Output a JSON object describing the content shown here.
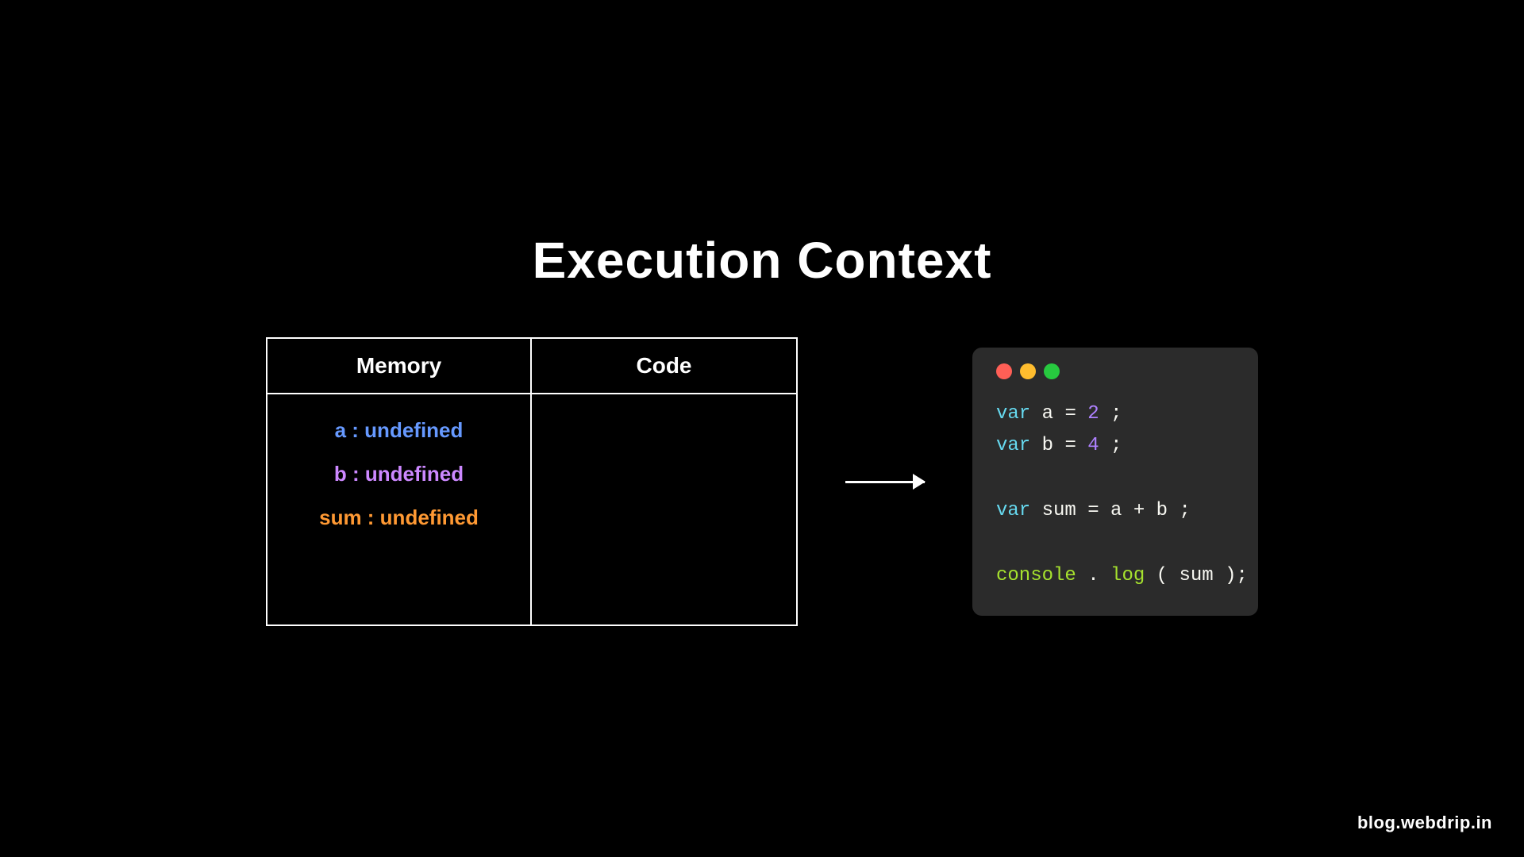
{
  "title": "Execution Context",
  "table": {
    "memory_header": "Memory",
    "code_header": "Code",
    "memory_items": [
      {
        "label": "a : undefined",
        "class": "var-a"
      },
      {
        "label": "b : undefined",
        "class": "var-b"
      },
      {
        "label": "sum : undefined",
        "class": "var-sum"
      }
    ]
  },
  "code": {
    "line1_kw": "var",
    "line1_var": "a",
    "line1_op": "=",
    "line1_num": "2",
    "line2_kw": "var",
    "line2_var": "b",
    "line2_op": "=",
    "line2_num": "4",
    "line3_kw": "var",
    "line3_var": "sum",
    "line3_op": "=",
    "line3_a": "a",
    "line3_plus": "+",
    "line3_b": "b",
    "line4_fn": "console",
    "line4_method": "log",
    "line4_arg": "sum"
  },
  "dots": [
    {
      "color": "red",
      "class": "dot-red"
    },
    {
      "color": "yellow",
      "class": "dot-yellow"
    },
    {
      "color": "green",
      "class": "dot-green"
    }
  ],
  "watermark": "blog.webdrip.in"
}
